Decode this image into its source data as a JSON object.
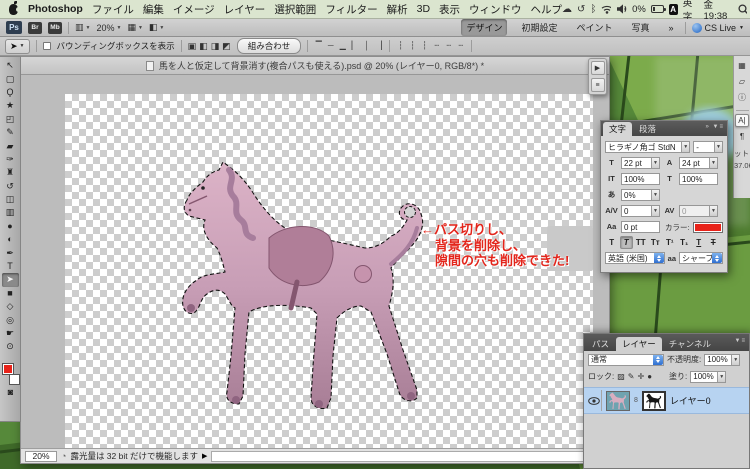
{
  "menu_bar": {
    "items": [
      "Photoshop",
      "ファイル",
      "編集",
      "イメージ",
      "レイヤー",
      "選択範囲",
      "フィルター",
      "解析",
      "3D",
      "表示",
      "ウィンドウ",
      "ヘルプ"
    ],
    "status": {
      "cloud_glyph": "☁",
      "sync_glyph": "↺",
      "bluetooth_glyph": "ᛒ",
      "battery_percent": "0%",
      "input_badge": "A",
      "input_mode": "英字",
      "clock": "金 19:38",
      "list_glyph": "≡"
    }
  },
  "app_bar": {
    "ps": "Ps",
    "br": "Br",
    "mb": "Mb",
    "arrange_glyph": "▥",
    "zoom_level": "20%",
    "extras_glyph": "▦",
    "screen_glyph": "◧",
    "workspaces": [
      {
        "name": "workspace-design",
        "label": "デザイン",
        "selected": true
      },
      {
        "name": "workspace-initial",
        "label": "初期設定"
      },
      {
        "name": "workspace-paint",
        "label": "ペイント"
      },
      {
        "name": "workspace-photo",
        "label": "写真"
      },
      {
        "name": "workspace-more",
        "label": "»"
      }
    ],
    "cs_live": "CS Live"
  },
  "options_bar": {
    "tool_glyph": "➤",
    "bounding_box_label": "バウンディングボックスを表示",
    "path_ops": [
      {
        "name": "path-op-add-icon",
        "glyph": "▣"
      },
      {
        "name": "path-op-subtract-icon",
        "glyph": "◧"
      },
      {
        "name": "path-op-intersect-icon",
        "glyph": "◨"
      },
      {
        "name": "path-op-exclude-icon",
        "glyph": "◩"
      }
    ],
    "combine_label": "組み合わせ",
    "align_icons": [
      {
        "name": "align-top-icon",
        "glyph": "▔"
      },
      {
        "name": "align-vcenter-icon",
        "glyph": "─"
      },
      {
        "name": "align-bottom-icon",
        "glyph": "▁"
      },
      {
        "name": "align-left-icon",
        "glyph": "▏"
      },
      {
        "name": "align-hcenter-icon",
        "glyph": "│"
      },
      {
        "name": "align-right-icon",
        "glyph": "▕"
      }
    ],
    "distribute_icons": [
      {
        "name": "distribute-top-icon",
        "glyph": "┆"
      },
      {
        "name": "distribute-vcenter-icon",
        "glyph": "┆"
      },
      {
        "name": "distribute-bottom-icon",
        "glyph": "┆"
      },
      {
        "name": "distribute-left-icon",
        "glyph": "┄"
      },
      {
        "name": "distribute-hcenter-icon",
        "glyph": "┄"
      },
      {
        "name": "distribute-right-icon",
        "glyph": "┄"
      }
    ]
  },
  "toolbar": {
    "tools": [
      {
        "name": "move-tool",
        "glyph": "↖"
      },
      {
        "name": "marquee-tool",
        "glyph": "▢"
      },
      {
        "name": "lasso-tool",
        "glyph": "Ϙ"
      },
      {
        "name": "quick-select-tool",
        "glyph": "★"
      },
      {
        "name": "crop-tool",
        "glyph": "◰"
      },
      {
        "name": "eyedropper-tool",
        "glyph": "✎"
      },
      {
        "name": "healing-brush-tool",
        "glyph": "▰"
      },
      {
        "name": "brush-tool",
        "glyph": "✑"
      },
      {
        "name": "clone-stamp-tool",
        "glyph": "♜"
      },
      {
        "name": "history-brush-tool",
        "glyph": "↺"
      },
      {
        "name": "eraser-tool",
        "glyph": "◫"
      },
      {
        "name": "gradient-tool",
        "glyph": "▥"
      },
      {
        "name": "blur-tool",
        "glyph": "●"
      },
      {
        "name": "dodge-tool",
        "glyph": "◐"
      },
      {
        "name": "pen-tool",
        "glyph": "✒"
      },
      {
        "name": "type-tool",
        "glyph": "T"
      },
      {
        "name": "path-selection-tool",
        "glyph": "➤",
        "selected": true
      },
      {
        "name": "shape-tool",
        "glyph": "■"
      },
      {
        "name": "3d-rotate-tool",
        "glyph": "◇"
      },
      {
        "name": "3d-orbit-tool",
        "glyph": "◎"
      },
      {
        "name": "hand-tool",
        "glyph": "☛"
      },
      {
        "name": "zoom-tool",
        "glyph": "⊙"
      }
    ],
    "foreground_color": "#e8231a",
    "background_color": "#ffffff",
    "quickmask_glyph": "◙"
  },
  "document": {
    "title": "馬を人と仮定して背景消す(複合パスも使える).psd @ 20% (レイヤー0, RGB/8*) *",
    "annotation": {
      "line1": "←パス切りし、",
      "line2": "背景を削除し、",
      "line3": "隙間の穴も削除できた!",
      "color": "#e3251b"
    },
    "status": {
      "zoom": "20%",
      "message": "露光量は 32 bit だけで機能します"
    }
  },
  "mini_dock": {
    "buttons": [
      {
        "name": "actions-panel-icon",
        "glyph": "▶"
      },
      {
        "name": "tool-presets-panel-icon",
        "glyph": "≡"
      }
    ]
  },
  "right_dock": {
    "icons_top": [
      {
        "name": "brush-panel-icon",
        "glyph": "▦"
      },
      {
        "name": "clone-source-panel-icon",
        "glyph": "▱"
      },
      {
        "name": "info-panel-icon",
        "glyph": "ⓘ"
      }
    ],
    "icons_text": [
      {
        "name": "character-panel-icon",
        "glyph": "A|",
        "selected": true
      },
      {
        "name": "paragraph-panel-icon",
        "glyph": "¶"
      }
    ],
    "fragment1": "ット",
    "fragment2": "37.06"
  },
  "character_panel": {
    "tabs": [
      {
        "name": "tab-character",
        "label": "文字",
        "selected": true
      },
      {
        "name": "tab-paragraph",
        "label": "段落"
      }
    ],
    "collapse_glyph": "»",
    "menu_glyph": "▼≡",
    "font_family": "ヒラギノ角ゴ StdN",
    "font_style": "-",
    "size_icon": "T",
    "size": "22 pt",
    "leading_icon": "A",
    "leading": "24 pt",
    "vscale_icon": "IT",
    "vscale": "100%",
    "hscale_icon": "T",
    "hscale": "100%",
    "tsume_icon": "あ",
    "tsume": "0%",
    "kerning_icon": "A/V",
    "kerning": "0",
    "tracking_icon": "AV",
    "tracking": "0",
    "baseline_icon": "Aa",
    "baseline": "0 pt",
    "color_label": "カラー:",
    "color": "#e8231a",
    "style_buttons": [
      {
        "name": "faux-bold-button",
        "glyph": "T"
      },
      {
        "name": "faux-italic-button",
        "glyph": "T",
        "selected": true
      },
      {
        "name": "all-caps-button",
        "glyph": "TT"
      },
      {
        "name": "small-caps-button",
        "glyph": "Tт"
      },
      {
        "name": "superscript-button",
        "glyph": "T¹"
      },
      {
        "name": "subscript-button",
        "glyph": "T₁"
      },
      {
        "name": "underline-button",
        "glyph": "T"
      },
      {
        "name": "strikethrough-button",
        "glyph": "T"
      }
    ],
    "language": "英語 (米国)",
    "aa_label": "aa",
    "antialias": "シャープ"
  },
  "layers_panel": {
    "tabs": [
      {
        "name": "tab-paths",
        "label": "パス"
      },
      {
        "name": "tab-layers",
        "label": "レイヤー",
        "selected": true
      },
      {
        "name": "tab-channels",
        "label": "チャンネル"
      }
    ],
    "menu_glyph": "▼≡",
    "blend_mode": "通常",
    "opacity_label": "不透明度:",
    "opacity": "100%",
    "lock_label": "ロック:",
    "lock_icons": [
      {
        "name": "lock-transparency-icon",
        "glyph": "▨"
      },
      {
        "name": "lock-paint-icon",
        "glyph": "✎"
      },
      {
        "name": "lock-move-icon",
        "glyph": "✛"
      },
      {
        "name": "lock-all-icon",
        "glyph": "●"
      }
    ],
    "fill_label": "塗り:",
    "fill": "100%",
    "layer": {
      "name": "レイヤー0",
      "link_glyph": "8"
    }
  }
}
